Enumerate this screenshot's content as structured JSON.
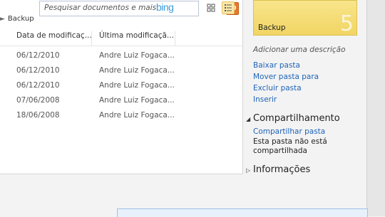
{
  "toolbar": {
    "search_placeholder": "Pesquisar documentos e mais",
    "search_provider": "bing",
    "icons": {
      "search": "search-icon",
      "thumbnail_view": "thumbnail-view-icon",
      "details_view": "details-view-icon"
    }
  },
  "breadcrumb": {
    "current": "Backup"
  },
  "table": {
    "columns": [
      "Data de modificaç...",
      "Última modificaçã..."
    ],
    "rows": [
      {
        "date": "06/12/2010",
        "modified_by": "Andre Luiz Fogaca..."
      },
      {
        "date": "06/12/2010",
        "modified_by": "Andre Luiz Fogaca..."
      },
      {
        "date": "06/12/2010",
        "modified_by": "Andre Luiz Fogaca..."
      },
      {
        "date": "07/06/2008",
        "modified_by": "Andre Luiz Fogaca..."
      },
      {
        "date": "18/06/2008",
        "modified_by": "Andre Luiz Fogaca..."
      }
    ]
  },
  "side": {
    "folder_tile": {
      "name": "Backup",
      "count": "5",
      "color": "#f3d96c"
    },
    "add_description": "Adicionar uma descrição",
    "actions": [
      "Baixar pasta",
      "Mover pasta para",
      "Excluir pasta",
      "Inserir"
    ],
    "sharing": {
      "title": "Compartilhamento",
      "link": "Compartilhar pasta",
      "status": "Esta pasta não está compartilhada"
    },
    "info": {
      "title": "Informações"
    }
  },
  "colors": {
    "link": "#1e63b8",
    "accent_orange": "#e8772e"
  }
}
